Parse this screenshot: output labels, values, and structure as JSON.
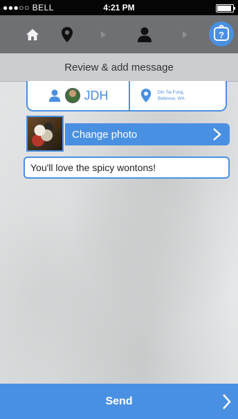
{
  "status_bar": {
    "carrier": "●●●○○ BELL",
    "time": "4:21 PM",
    "battery_level": 0.9
  },
  "nav": {
    "icons": [
      "home-icon",
      "pin-icon",
      "step-arrow-icon",
      "person-icon",
      "step-arrow-icon",
      "help-icon"
    ],
    "active": "help-icon",
    "accent": "#4a90e2"
  },
  "page": {
    "title": "Review & add message"
  },
  "info_card": {
    "user_initials": "JDH",
    "place_line1": "Din Tai Fung,",
    "place_line2": "Bellevue, WA"
  },
  "photo": {
    "change_label": "Change photo"
  },
  "message": {
    "text": "You'll love the spicy wontons!"
  },
  "send": {
    "label": "Send"
  }
}
